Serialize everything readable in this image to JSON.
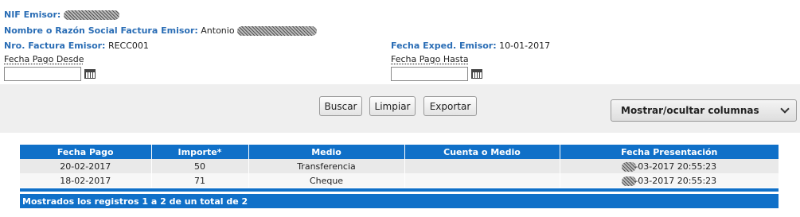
{
  "emisor": {
    "nif_label": "NIF Emisor:",
    "nombre_label": "Nombre o Razón Social Factura Emisor:",
    "nombre_value": "Antonio",
    "factura_label": "Nro. Factura Emisor:",
    "factura_value": "RECC001",
    "fecha_exped_label": "Fecha Exped. Emisor:",
    "fecha_exped_value": "10-01-2017"
  },
  "filters": {
    "desde_label": "Fecha Pago Desde",
    "hasta_label": "Fecha Pago Hasta",
    "desde_value": "",
    "hasta_value": ""
  },
  "actions": {
    "buscar": "Buscar",
    "limpiar": "Limpiar",
    "exportar": "Exportar",
    "columns_toggle": "Mostrar/ocultar columnas"
  },
  "table": {
    "headers": [
      "Fecha Pago",
      "Importe*",
      "Medio",
      "Cuenta o Medio",
      "Fecha Presentación"
    ],
    "rows": [
      [
        "20-02-2017",
        "50",
        "Transferencia",
        "",
        "-03-2017 20:55:23"
      ],
      [
        "18-02-2017",
        "71",
        "Cheque",
        "",
        "-03-2017 20:55:23"
      ]
    ],
    "footer": "Mostrados los registros 1 a 2 de un total de 2"
  }
}
